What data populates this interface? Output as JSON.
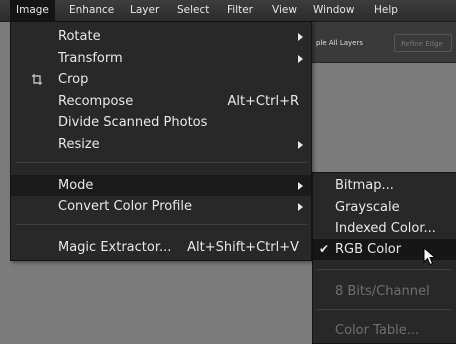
{
  "menubar": {
    "items": [
      {
        "label": "Image"
      },
      {
        "label": "Enhance"
      },
      {
        "label": "Layer"
      },
      {
        "label": "Select"
      },
      {
        "label": "Filter"
      },
      {
        "label": "View"
      },
      {
        "label": "Window"
      },
      {
        "label": "Help"
      }
    ]
  },
  "options_bar": {
    "sample_all_layers": "ple All Layers",
    "refine_edge": "Refine Edge"
  },
  "image_menu": {
    "items": [
      {
        "label": "Rotate",
        "submenu": true
      },
      {
        "label": "Transform",
        "submenu": true
      },
      {
        "label": "Crop",
        "icon": "crop-icon"
      },
      {
        "label": "Recompose",
        "shortcut": "Alt+Ctrl+R"
      },
      {
        "label": "Divide Scanned Photos"
      },
      {
        "label": "Resize",
        "submenu": true
      },
      {
        "label": "Mode",
        "submenu": true,
        "highlighted": true
      },
      {
        "label": "Convert Color Profile",
        "submenu": true
      },
      {
        "label": "Magic Extractor...",
        "shortcut": "Alt+Shift+Ctrl+V"
      }
    ]
  },
  "mode_submenu": {
    "items": [
      {
        "label": "Bitmap..."
      },
      {
        "label": "Grayscale"
      },
      {
        "label": "Indexed Color..."
      },
      {
        "label": "RGB Color",
        "checked": true
      },
      {
        "label": "8 Bits/Channel",
        "disabled": true
      },
      {
        "label": "Color Table...",
        "disabled": true
      }
    ]
  },
  "colors": {
    "menu_bg": "#282828",
    "highlight": "#1a1a1a",
    "canvas": "#7b7b7b",
    "text": "#e8e8e8",
    "disabled_text": "#6f6f6f"
  }
}
